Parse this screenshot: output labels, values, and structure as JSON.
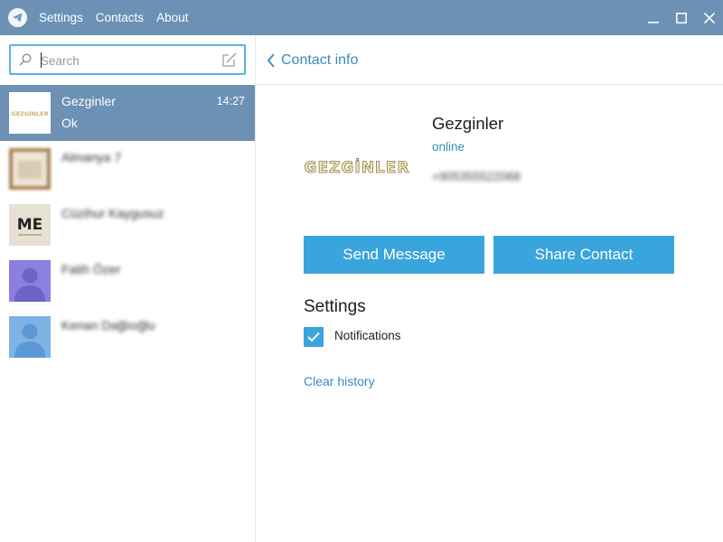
{
  "menu": {
    "settings": "Settings",
    "contacts": "Contacts",
    "about": "About"
  },
  "search": {
    "placeholder": "Search",
    "value": ""
  },
  "chats": [
    {
      "name": "Gezginler",
      "time": "14:27",
      "preview": "Ok",
      "avatar_text": "GEZGİNLER",
      "active": true
    },
    {
      "name": "Almanya 7",
      "time": "",
      "preview": ""
    },
    {
      "name": "Cüzihur Kaygusuz",
      "time": "",
      "preview": "",
      "avatar_text": "ME"
    },
    {
      "name": "Fatih Özer",
      "time": "",
      "preview": ""
    },
    {
      "name": "Kenan Dağlıoğlu",
      "time": "",
      "preview": ""
    }
  ],
  "header": {
    "back_label": "Contact info"
  },
  "profile": {
    "name": "Gezginler",
    "status": "online",
    "phone": "+905355522068",
    "photo_text": "GEZGİNLER"
  },
  "actions": {
    "send_message": "Send Message",
    "share_contact": "Share Contact"
  },
  "settings": {
    "title": "Settings",
    "notifications_label": "Notifications",
    "notifications_checked": true,
    "clear_history": "Clear history"
  },
  "colors": {
    "titlebar": "#6c91b4",
    "active_row": "#6c91b4",
    "accent": "#39a5dc",
    "link": "#3a8bbb",
    "search_border": "#5fb2de"
  },
  "icons": {
    "app": "telegram-plane-icon",
    "search": "search-icon",
    "compose": "compose-icon",
    "back": "chevron-left-icon",
    "minimize": "minimize-icon",
    "maximize": "maximize-icon",
    "close": "close-icon",
    "check": "check-icon"
  }
}
